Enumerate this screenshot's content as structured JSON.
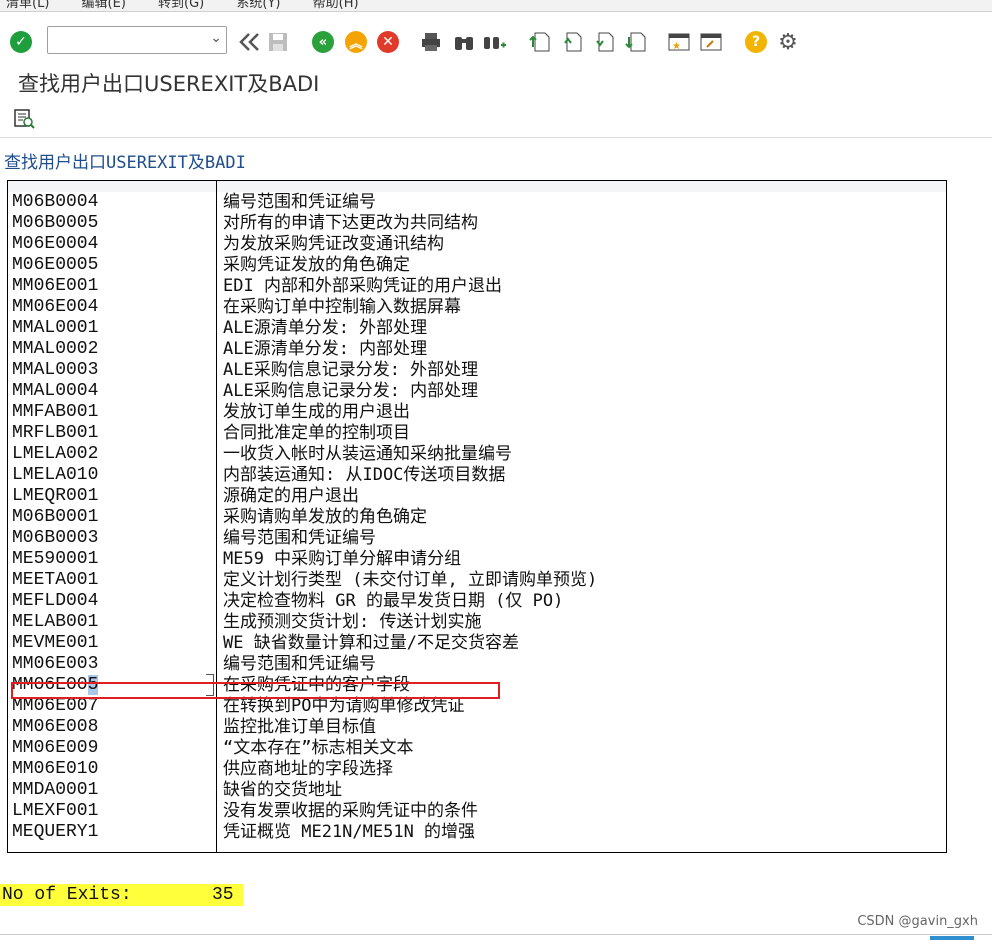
{
  "menubar": {
    "items": [
      "清单(L)",
      "编辑(E)",
      "转到(G)",
      "系统(Y)",
      "帮助(H)"
    ]
  },
  "toolbar": {
    "command_value": "",
    "icons": [
      "enter-icon",
      "back-nav-icon",
      "save-icon",
      "back-icon",
      "exit-icon",
      "cancel-icon",
      "print-icon",
      "find-icon",
      "find-next-icon",
      "first-page-icon",
      "prev-page-icon",
      "next-page-icon",
      "last-page-icon",
      "new-session-icon",
      "shortcut-icon",
      "help-icon",
      "settings-icon"
    ]
  },
  "title": "查找用户出口USEREXIT及BADI",
  "report_heading": "查找用户出口USEREXIT及BADI",
  "exits": [
    {
      "name": "M06B0004",
      "text": "编号范围和凭证编号"
    },
    {
      "name": "M06B0005",
      "text": "对所有的申请下达更改为共同结构"
    },
    {
      "name": "M06E0004",
      "text": "为发放采购凭证改变通讯结构"
    },
    {
      "name": "M06E0005",
      "text": "采购凭证发放的角色确定"
    },
    {
      "name": "MM06E001",
      "text": "EDI 内部和外部采购凭证的用户退出"
    },
    {
      "name": "MM06E004",
      "text": "在采购订单中控制输入数据屏幕"
    },
    {
      "name": "MMAL0001",
      "text": "ALE源清单分发: 外部处理"
    },
    {
      "name": "MMAL0002",
      "text": "ALE源清单分发: 内部处理"
    },
    {
      "name": "MMAL0003",
      "text": "ALE采购信息记录分发: 外部处理"
    },
    {
      "name": "MMAL0004",
      "text": "ALE采购信息记录分发: 内部处理"
    },
    {
      "name": "MMFAB001",
      "text": "发放订单生成的用户退出"
    },
    {
      "name": "MRFLB001",
      "text": "合同批准定单的控制项目"
    },
    {
      "name": "LMELA002",
      "text": "一收货入帐时从装运通知采纳批量编号"
    },
    {
      "name": "LMELA010",
      "text": "内部装运通知: 从IDOC传送项目数据"
    },
    {
      "name": "LMEQR001",
      "text": "源确定的用户退出"
    },
    {
      "name": "M06B0001",
      "text": "采购请购单发放的角色确定"
    },
    {
      "name": "M06B0003",
      "text": "编号范围和凭证编号"
    },
    {
      "name": "ME590001",
      "text": "ME59 中采购订单分解申请分组"
    },
    {
      "name": "MEETA001",
      "text": "定义计划行类型 (未交付订单, 立即请购单预览)"
    },
    {
      "name": "MEFLD004",
      "text": "决定检查物料 GR 的最早发货日期 (仅 PO)"
    },
    {
      "name": "MELAB001",
      "text": "生成预测交货计划: 传送计划实施"
    },
    {
      "name": "MEVME001",
      "text": "WE 缺省数量计算和过量/不足交货容差"
    },
    {
      "name": "MM06E003",
      "text": "编号范围和凭证编号"
    },
    {
      "name": "MM06E005",
      "text": "在采购凭证中的客户字段"
    },
    {
      "name": "MM06E007",
      "text": "在转换到PO中为请购单修改凭证"
    },
    {
      "name": "MM06E008",
      "text": "监控批准订单目标值"
    },
    {
      "name": "MM06E009",
      "text": "“文本存在”标志相关文本"
    },
    {
      "name": "MM06E010",
      "text": "供应商地址的字段选择"
    },
    {
      "name": "MMDA0001",
      "text": "缺省的交货地址"
    },
    {
      "name": "LMEXF001",
      "text": "没有发票收据的采购凭证中的条件"
    },
    {
      "name": "MEQUERY1",
      "text": "凭证概览 ME21N/ME51N 的增强"
    }
  ],
  "highlighted_exit": "MM06E005",
  "footer": {
    "count_label": "No of Exits:",
    "count_value": "35"
  },
  "watermark": "CSDN @gavin_gxh",
  "colors": {
    "enter_green": "#1e9e3c",
    "nav_green": "#2aa13a",
    "exit_orange": "#f5a300",
    "cancel_red": "#e03a2a",
    "help_yellow": "#f2b400",
    "heading_blue": "#1f4e8c",
    "highlight_yellow": "#ffff3b",
    "annotation_red": "#e02020"
  }
}
